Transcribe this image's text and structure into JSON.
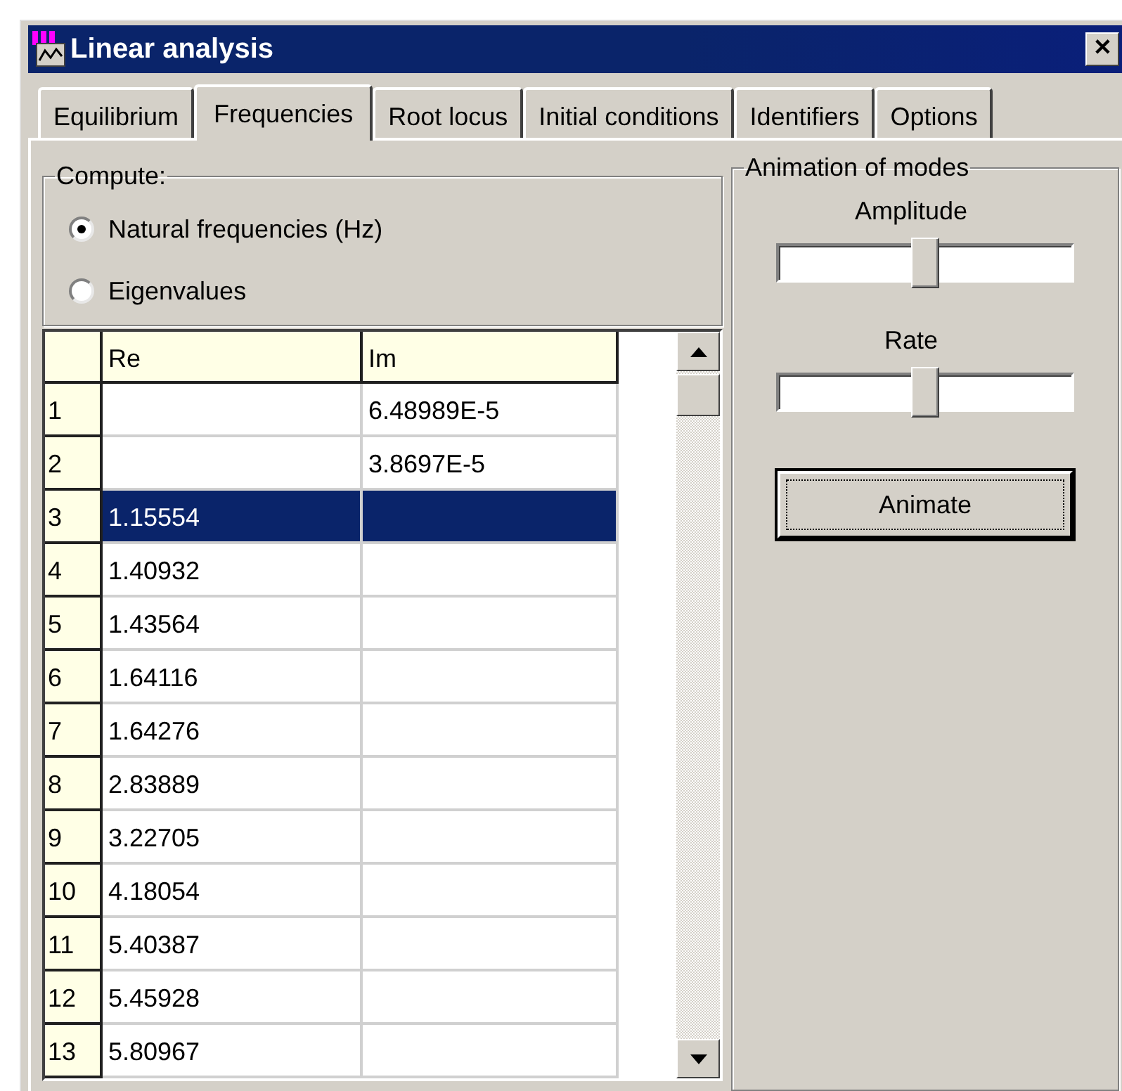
{
  "window": {
    "title": "Linear analysis",
    "close": "✕"
  },
  "tabs": [
    {
      "label": "Equilibrium",
      "selected": false
    },
    {
      "label": "Frequencies",
      "selected": true
    },
    {
      "label": "Root locus",
      "selected": false
    },
    {
      "label": "Initial conditions",
      "selected": false
    },
    {
      "label": "Identifiers",
      "selected": false
    },
    {
      "label": "Options",
      "selected": false
    }
  ],
  "compute": {
    "title": "Compute:",
    "options": [
      {
        "label": "Natural frequencies (Hz)",
        "selected": true
      },
      {
        "label": "Eigenvalues",
        "selected": false
      }
    ]
  },
  "table": {
    "columns": [
      "Re",
      "Im"
    ],
    "rows": [
      {
        "index": "1",
        "re": "",
        "im": "6.48989E-5",
        "selected": false
      },
      {
        "index": "2",
        "re": "",
        "im": "3.8697E-5",
        "selected": false
      },
      {
        "index": "3",
        "re": "1.15554",
        "im": "",
        "selected": true
      },
      {
        "index": "4",
        "re": "1.40932",
        "im": "",
        "selected": false
      },
      {
        "index": "5",
        "re": "1.43564",
        "im": "",
        "selected": false
      },
      {
        "index": "6",
        "re": "1.64116",
        "im": "",
        "selected": false
      },
      {
        "index": "7",
        "re": "1.64276",
        "im": "",
        "selected": false
      },
      {
        "index": "8",
        "re": "2.83889",
        "im": "",
        "selected": false
      },
      {
        "index": "9",
        "re": "3.22705",
        "im": "",
        "selected": false
      },
      {
        "index": "10",
        "re": "4.18054",
        "im": "",
        "selected": false
      },
      {
        "index": "11",
        "re": "5.40387",
        "im": "",
        "selected": false
      },
      {
        "index": "12",
        "re": "5.45928",
        "im": "",
        "selected": false
      },
      {
        "index": "13",
        "re": "5.80967",
        "im": "",
        "selected": false
      }
    ]
  },
  "animation": {
    "title": "Animation of modes",
    "sliders": [
      {
        "label": "Amplitude",
        "level": 0.5
      },
      {
        "label": "Rate",
        "level": 0.5
      }
    ],
    "button": "Animate"
  }
}
